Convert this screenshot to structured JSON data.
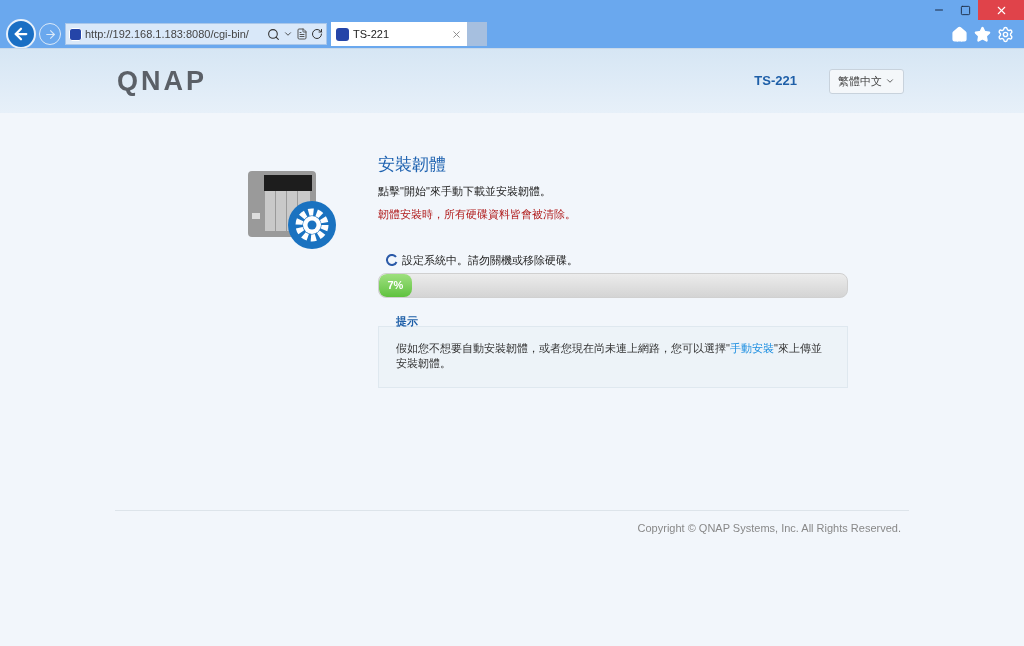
{
  "browser": {
    "address": "http://192.168.1.183:8080/cgi-bin/",
    "tabs": [
      {
        "title": "TS-221",
        "selected": true
      }
    ]
  },
  "header": {
    "logo": "QNAP",
    "model": "TS-221",
    "language": "繁體中文"
  },
  "install": {
    "title": "安裝韌體",
    "instruction": "點擊\"開始\"來手動下載並安裝韌體。",
    "warning": "韌體安裝時，所有硬碟資料皆會被清除。",
    "status": "設定系統中。請勿關機或移除硬碟。",
    "progress": {
      "level": 0.07,
      "label": "7%"
    }
  },
  "tip": {
    "title": "提示",
    "before": "假如您不想要自動安裝韌體，或者您現在尚未連上網路，您可以選擇\"",
    "link": "手動安裝",
    "after": "\"來上傳並安裝韌體。"
  },
  "footer": {
    "copyright": "Copyright © QNAP Systems, Inc. All Rights Reserved."
  }
}
